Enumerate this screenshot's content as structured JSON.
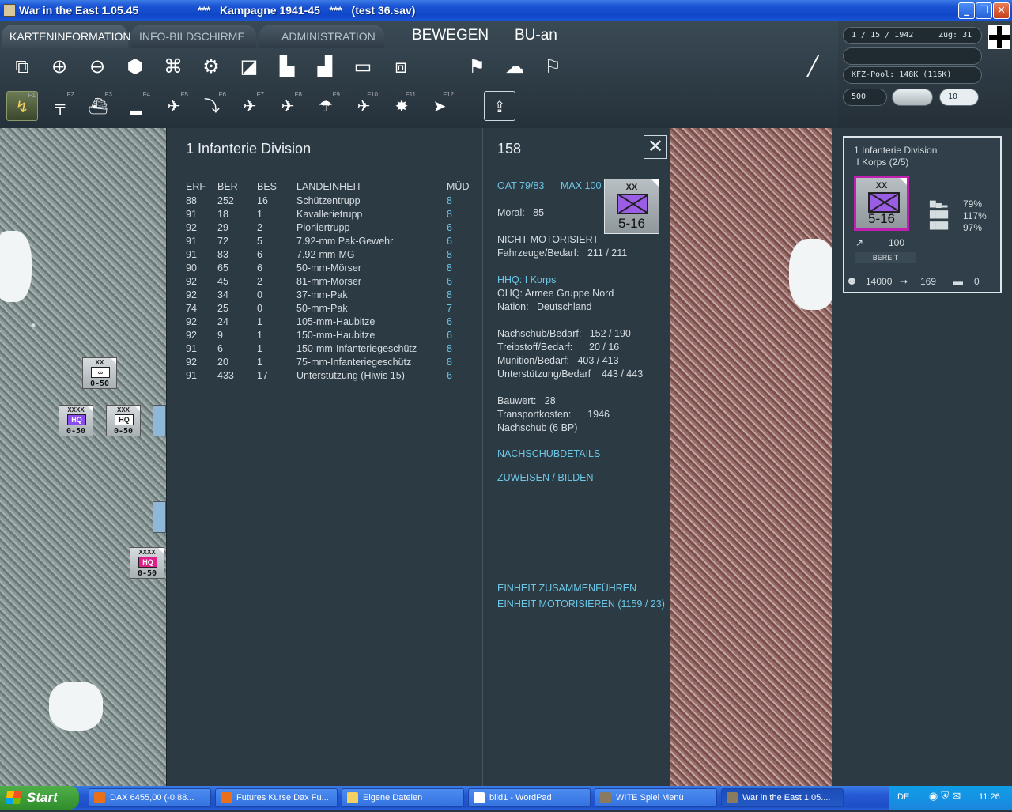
{
  "window": {
    "title": "War in the East 1.05.45",
    "subtitle": "***   Kampagne 1941-45   ***   (test 36.sav)",
    "btn_min": "_",
    "btn_max": "❐",
    "btn_close": "✕"
  },
  "tabs": [
    {
      "label": "KARTENINFORMATION"
    },
    {
      "label": "INFO-BILDSCHIRME"
    },
    {
      "label": "ADMINISTRATION"
    }
  ],
  "mode": {
    "move": "BEWEGEN",
    "bu": "BU-an"
  },
  "fkeys": [
    "F1",
    "F2",
    "F3",
    "F4",
    "F5",
    "F6",
    "F7",
    "F8",
    "F9",
    "F10",
    "F11",
    "F12"
  ],
  "topinfo": {
    "date": "1 / 15 / 1942",
    "turn": "Zug: 31",
    "kfz": "KFZ-Pool: 148K (116K)",
    "val500": "500",
    "val10": "10"
  },
  "dialog": {
    "title": "1 Infanterie Division",
    "id": "158",
    "close": "✕",
    "headers": [
      "ERF",
      "BER",
      "BES",
      "LANDEINHEIT",
      "MÜD"
    ],
    "rows": [
      [
        "88",
        "252",
        "16",
        "Schützentrupp",
        "8"
      ],
      [
        "91",
        "18",
        "1",
        "Kavallerietrupp",
        "8"
      ],
      [
        "92",
        "29",
        "2",
        "Pioniertrupp",
        "6"
      ],
      [
        "91",
        "72",
        "5",
        "7.92-mm Pak-Gewehr",
        "6"
      ],
      [
        "91",
        "83",
        "6",
        "7.92-mm-MG",
        "8"
      ],
      [
        "90",
        "65",
        "6",
        "50-mm-Mörser",
        "8"
      ],
      [
        "92",
        "45",
        "2",
        "81-mm-Mörser",
        "6"
      ],
      [
        "92",
        "34",
        "0",
        "37-mm-Pak",
        "8"
      ],
      [
        "74",
        "25",
        "0",
        "50-mm-Pak",
        "7"
      ],
      [
        "92",
        "24",
        "1",
        "105-mm-Haubitze",
        "6"
      ],
      [
        "92",
        "9",
        "1",
        "150-mm-Haubitze",
        "6"
      ],
      [
        "91",
        "6",
        "1",
        "150-mm-Infanteriegeschütz",
        "8"
      ],
      [
        "92",
        "20",
        "1",
        "75-mm-Infanteriegeschütz",
        "8"
      ],
      [
        "91",
        "433",
        "17",
        "Unterstützung (Hiwis 15)",
        "6"
      ]
    ],
    "oat": "OAT 79/83",
    "max": "MAX 100",
    "moral": "Moral:   85",
    "motor": "NICHT-MOTORISIERT",
    "vehicles": "Fahrzeuge/Bedarf:   211 / 211",
    "hhq": "HHQ: I Korps",
    "ohq": "OHQ: Armee Gruppe Nord",
    "nation": "Nation:   Deutschland",
    "supply": "Nachschub/Bedarf:   152 / 190",
    "fuel": "Treibstoff/Bedarf:      20 / 16",
    "ammo": "Munition/Bedarf:   403 / 413",
    "support": "Unterstützung/Bedarf    443 / 443",
    "build": "Bauwert:   28",
    "transport": "Transportkosten:      1946",
    "nachschub_bp": "Nachschub (6 BP)",
    "link_details": "NACHSCHUBDETAILS",
    "link_assign": "ZUWEISEN / BILDEN",
    "link_merge": "EINHEIT ZUSAMMENFÜHREN",
    "link_motorize": "EINHEIT MOTORISIEREN (1159 / 23)",
    "counter": {
      "size": "XX",
      "value": "5-16"
    }
  },
  "side": {
    "name": "1 Infanterie Division",
    "corps": " I Korps (2/5)",
    "pct1": "79%",
    "pct2": "117%",
    "pct3": "97%",
    "move": "100",
    "status": "BEREIT",
    "men": "14000",
    "guns": "169",
    "tanks": "0",
    "counter": {
      "size": "XX",
      "value": "5-16"
    }
  },
  "map_counters": [
    {
      "top": "XX",
      "box": "∞",
      "bottom": "0-50"
    },
    {
      "top": "XXXX",
      "box": "HQ",
      "bottom": "0-50"
    },
    {
      "top": "XXX",
      "box": "HQ",
      "bottom": "0-50"
    },
    {
      "top": "XXXX",
      "box": "HQ",
      "bottom": "0-50"
    }
  ],
  "taskbar": {
    "start": "Start",
    "items": [
      {
        "label": "DAX 6455,00 (-0,88..."
      },
      {
        "label": "Futures Kurse Dax Fu..."
      },
      {
        "label": "Eigene Dateien"
      },
      {
        "label": "bild1 - WordPad"
      },
      {
        "label": "WITE  Spiel Menü"
      },
      {
        "label": "War in the East 1.05...."
      }
    ],
    "lang": "DE",
    "clock": "11:26"
  },
  "colors": {
    "accent_link": "#6cc6e6",
    "division_symbol": "#9b5de5",
    "hq_purple": "#8a4cf0",
    "hq_pink": "#e0208a"
  }
}
